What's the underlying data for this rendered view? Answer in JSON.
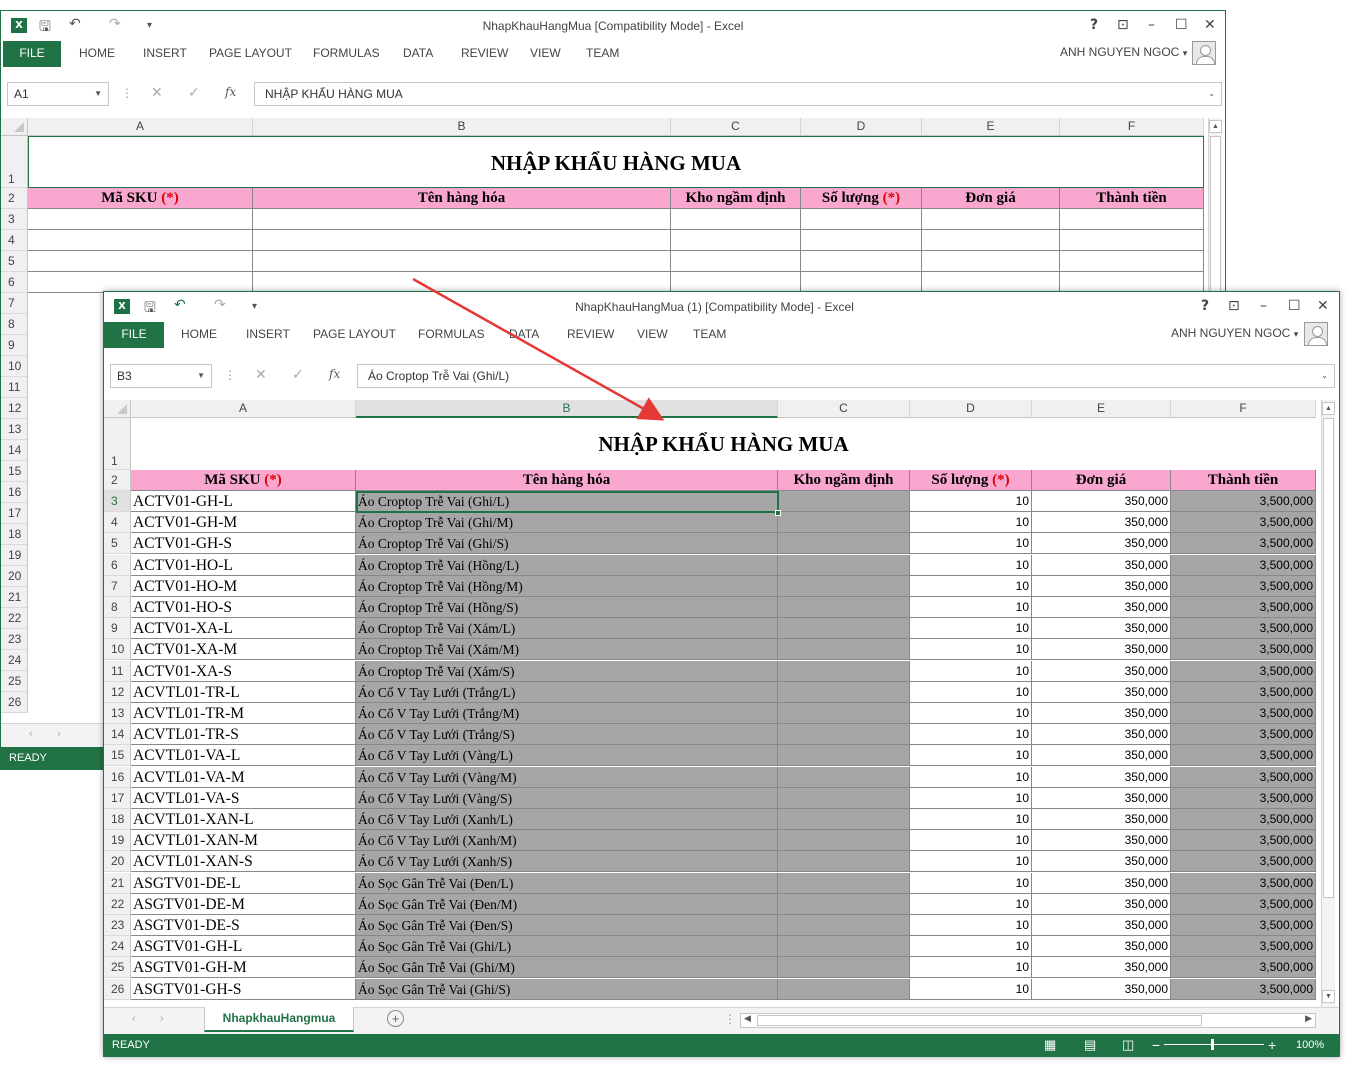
{
  "back_window": {
    "title": "NhapKhauHangMua  [Compatibility Mode] - Excel",
    "name_box": "A1",
    "formula": "NHẬP KHẨU HÀNG MUA",
    "status": "READY",
    "row_numbers": [
      "1",
      "2",
      "3",
      "4",
      "5",
      "6",
      "7",
      "8",
      "9",
      "10",
      "11",
      "12",
      "13",
      "14",
      "15",
      "16",
      "17",
      "18",
      "19",
      "20",
      "21",
      "22",
      "23",
      "24",
      "25",
      "26"
    ]
  },
  "front_window": {
    "title": "NhapKhauHangMua (1)  [Compatibility Mode] - Excel",
    "name_box": "B3",
    "formula": "Áo Croptop Trễ Vai (Ghi/L)",
    "status": "READY",
    "sheet_tab": "NhapkhauHangmua",
    "zoom": "100%"
  },
  "ribbon": {
    "tabs": [
      "FILE",
      "HOME",
      "INSERT",
      "PAGE LAYOUT",
      "FORMULAS",
      "DATA",
      "REVIEW",
      "VIEW",
      "TEAM"
    ],
    "user": "ANH NGUYEN NGOC"
  },
  "window_controls": {
    "help": "?",
    "ribbon_opts": "⊡",
    "minimize": "–",
    "maximize": "☐",
    "close": "✕"
  },
  "columns": [
    "A",
    "B",
    "C",
    "D",
    "E",
    "F"
  ],
  "sheet": {
    "title": "NHẬP KHẨU HÀNG MUA",
    "headers": {
      "sku": "Mã SKU ",
      "sku_star": "(*)",
      "name": "Tên hàng hóa",
      "warehouse": "Kho ngầm định",
      "qty": "Số lượng ",
      "qty_star": "(*)",
      "price": "Đơn giá",
      "total": "Thành tiền"
    },
    "rows": [
      {
        "n": "3",
        "sku": "ACTV01-GH-L",
        "name": "Áo Croptop Trễ Vai (Ghi/L)",
        "qty": "10",
        "price": "350,000",
        "total": "3,500,000"
      },
      {
        "n": "4",
        "sku": "ACTV01-GH-M",
        "name": "Áo Croptop Trễ Vai (Ghi/M)",
        "qty": "10",
        "price": "350,000",
        "total": "3,500,000"
      },
      {
        "n": "5",
        "sku": "ACTV01-GH-S",
        "name": "Áo Croptop Trễ Vai (Ghi/S)",
        "qty": "10",
        "price": "350,000",
        "total": "3,500,000"
      },
      {
        "n": "6",
        "sku": "ACTV01-HO-L",
        "name": "Áo Croptop Trễ Vai (Hồng/L)",
        "qty": "10",
        "price": "350,000",
        "total": "3,500,000"
      },
      {
        "n": "7",
        "sku": "ACTV01-HO-M",
        "name": "Áo Croptop Trễ Vai (Hồng/M)",
        "qty": "10",
        "price": "350,000",
        "total": "3,500,000"
      },
      {
        "n": "8",
        "sku": "ACTV01-HO-S",
        "name": "Áo Croptop Trễ Vai (Hồng/S)",
        "qty": "10",
        "price": "350,000",
        "total": "3,500,000"
      },
      {
        "n": "9",
        "sku": "ACTV01-XA-L",
        "name": "Áo Croptop Trễ Vai (Xám/L)",
        "qty": "10",
        "price": "350,000",
        "total": "3,500,000"
      },
      {
        "n": "10",
        "sku": "ACTV01-XA-M",
        "name": "Áo Croptop Trễ Vai (Xám/M)",
        "qty": "10",
        "price": "350,000",
        "total": "3,500,000"
      },
      {
        "n": "11",
        "sku": "ACTV01-XA-S",
        "name": "Áo Croptop Trễ Vai (Xám/S)",
        "qty": "10",
        "price": "350,000",
        "total": "3,500,000"
      },
      {
        "n": "12",
        "sku": "ACVTL01-TR-L",
        "name": "Áo Cổ V Tay Lưới (Trắng/L)",
        "qty": "10",
        "price": "350,000",
        "total": "3,500,000"
      },
      {
        "n": "13",
        "sku": "ACVTL01-TR-M",
        "name": "Áo Cổ V Tay Lưới (Trắng/M)",
        "qty": "10",
        "price": "350,000",
        "total": "3,500,000"
      },
      {
        "n": "14",
        "sku": "ACVTL01-TR-S",
        "name": "Áo Cổ V Tay Lưới (Trắng/S)",
        "qty": "10",
        "price": "350,000",
        "total": "3,500,000"
      },
      {
        "n": "15",
        "sku": "ACVTL01-VA-L",
        "name": "Áo Cổ V Tay Lưới (Vàng/L)",
        "qty": "10",
        "price": "350,000",
        "total": "3,500,000"
      },
      {
        "n": "16",
        "sku": "ACVTL01-VA-M",
        "name": "Áo Cổ V Tay Lưới (Vàng/M)",
        "qty": "10",
        "price": "350,000",
        "total": "3,500,000"
      },
      {
        "n": "17",
        "sku": "ACVTL01-VA-S",
        "name": "Áo Cổ V Tay Lưới (Vàng/S)",
        "qty": "10",
        "price": "350,000",
        "total": "3,500,000"
      },
      {
        "n": "18",
        "sku": "ACVTL01-XAN-L",
        "name": "Áo Cổ V Tay Lưới (Xanh/L)",
        "qty": "10",
        "price": "350,000",
        "total": "3,500,000"
      },
      {
        "n": "19",
        "sku": "ACVTL01-XAN-M",
        "name": "Áo Cổ V Tay Lưới (Xanh/M)",
        "qty": "10",
        "price": "350,000",
        "total": "3,500,000"
      },
      {
        "n": "20",
        "sku": "ACVTL01-XAN-S",
        "name": "Áo Cổ V Tay Lưới (Xanh/S)",
        "qty": "10",
        "price": "350,000",
        "total": "3,500,000"
      },
      {
        "n": "21",
        "sku": "ASGTV01-DE-L",
        "name": "Áo Sọc Gân Trễ Vai (Đen/L)",
        "qty": "10",
        "price": "350,000",
        "total": "3,500,000"
      },
      {
        "n": "22",
        "sku": "ASGTV01-DE-M",
        "name": "Áo Sọc Gân Trễ Vai (Đen/M)",
        "qty": "10",
        "price": "350,000",
        "total": "3,500,000"
      },
      {
        "n": "23",
        "sku": "ASGTV01-DE-S",
        "name": "Áo Sọc Gân Trễ Vai (Đen/S)",
        "qty": "10",
        "price": "350,000",
        "total": "3,500,000"
      },
      {
        "n": "24",
        "sku": "ASGTV01-GH-L",
        "name": "Áo Sọc Gân Trễ Vai (Ghi/L)",
        "qty": "10",
        "price": "350,000",
        "total": "3,500,000"
      },
      {
        "n": "25",
        "sku": "ASGTV01-GH-M",
        "name": "Áo Sọc Gân Trễ Vai (Ghi/M)",
        "qty": "10",
        "price": "350,000",
        "total": "3,500,000"
      },
      {
        "n": "26",
        "sku": "ASGTV01-GH-S",
        "name": "Áo Sọc Gân Trễ Vai (Ghi/S)",
        "qty": "10",
        "price": "350,000",
        "total": "3,500,000"
      }
    ]
  },
  "colors": {
    "excel_green": "#217346",
    "header_pink": "#f9a7cf",
    "grey_fill": "#a6a6a6",
    "arrow_red": "#e53935"
  }
}
